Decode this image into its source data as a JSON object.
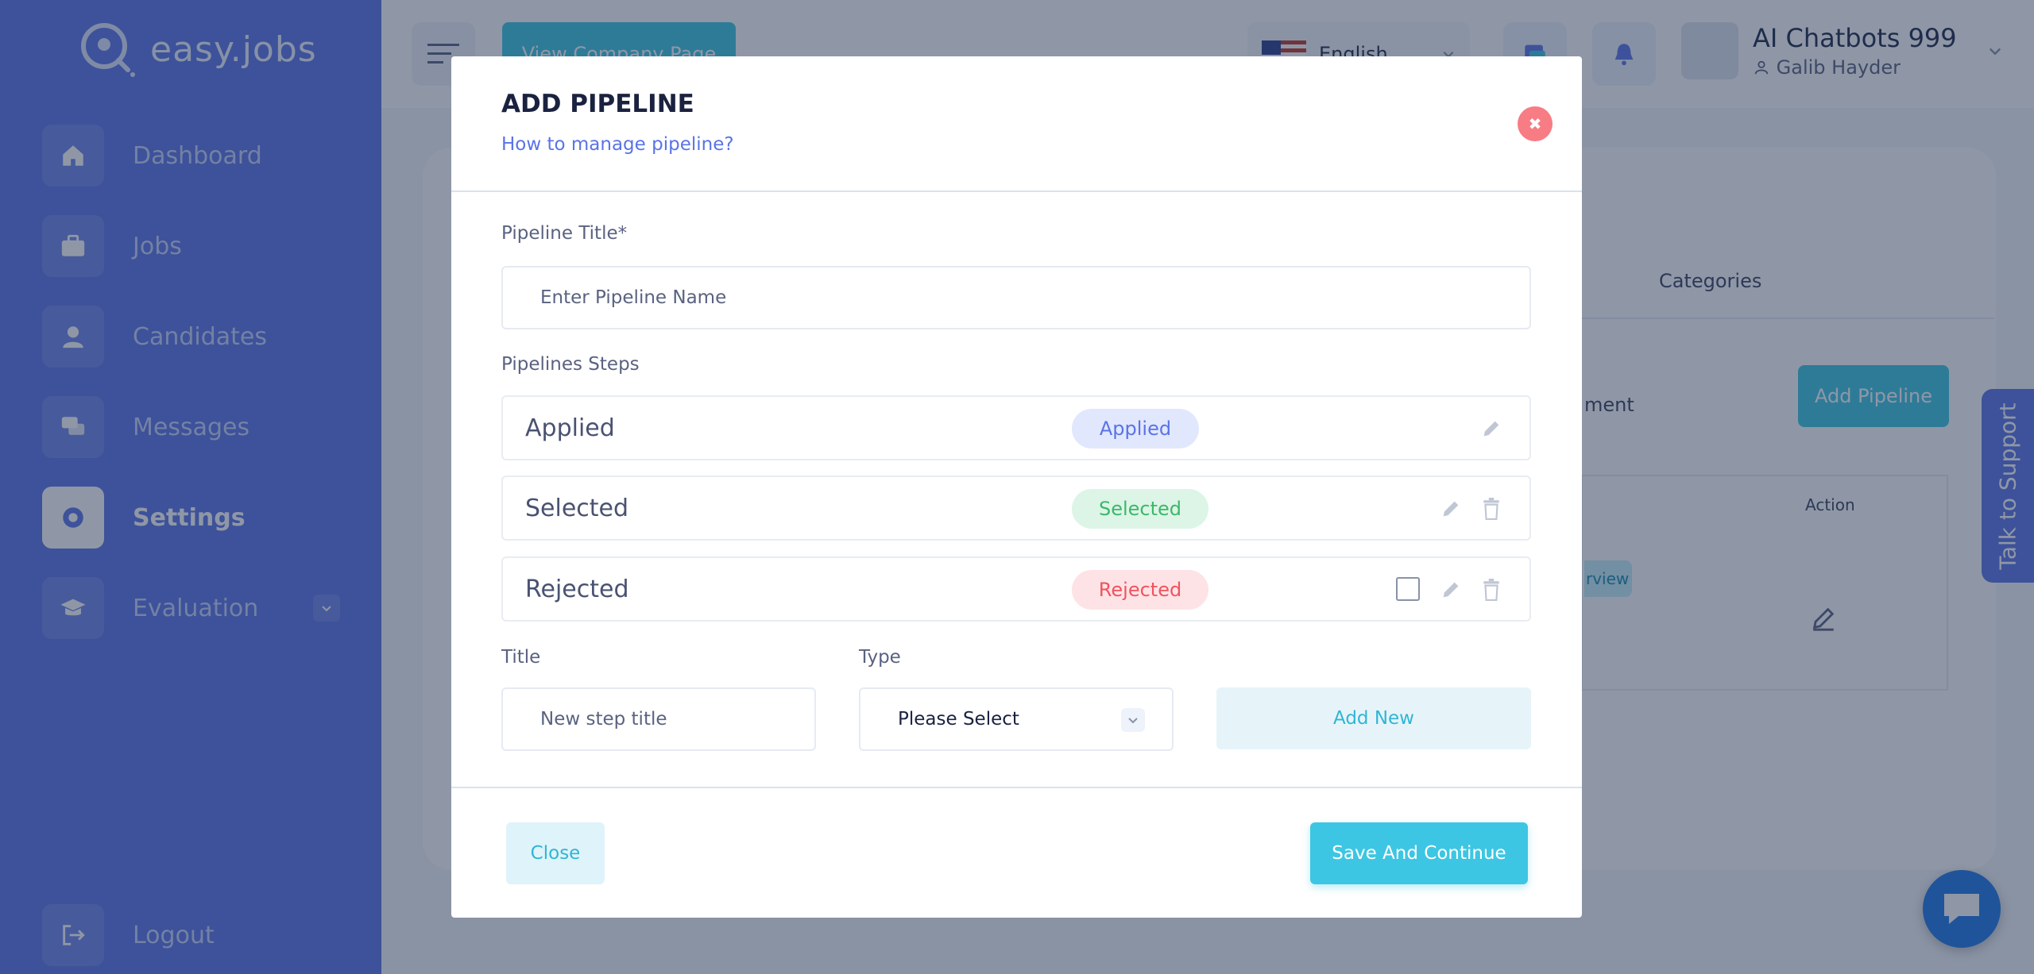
{
  "brand": {
    "name": "easy.jobs"
  },
  "sidebar": {
    "items": [
      {
        "label": "Dashboard",
        "icon": "home-icon"
      },
      {
        "label": "Jobs",
        "icon": "briefcase-icon"
      },
      {
        "label": "Candidates",
        "icon": "user-icon"
      },
      {
        "label": "Messages",
        "icon": "chat-icon"
      },
      {
        "label": "Settings",
        "icon": "gear-icon",
        "active": true
      },
      {
        "label": "Evaluation",
        "icon": "graduation-cap-icon"
      }
    ],
    "logout": "Logout"
  },
  "header": {
    "company_page_button": "View Company Page",
    "language": "English",
    "company": "AI Chatbots 999",
    "user": "Galib Hayder"
  },
  "background": {
    "tab_categories": "Categories",
    "add_pipeline_button": "Add Pipeline",
    "text_fragment": "ment",
    "table_action_header": "Action",
    "view_fragment": "rview"
  },
  "support": {
    "tab": "Talk to Support"
  },
  "modal": {
    "title": "ADD PIPELINE",
    "help_link": "How to manage pipeline?",
    "pipeline_title_label": "Pipeline Title*",
    "pipeline_title_placeholder": "Enter Pipeline Name",
    "steps_label": "Pipelines Steps",
    "steps": [
      {
        "name": "Applied",
        "badge": "Applied"
      },
      {
        "name": "Selected",
        "badge": "Selected"
      },
      {
        "name": "Rejected",
        "badge": "Rejected"
      }
    ],
    "title_label": "Title",
    "title_placeholder": "New step title",
    "type_label": "Type",
    "type_value": "Please Select",
    "add_new_button": "Add New",
    "close_button": "Close",
    "save_button": "Save And Continue"
  },
  "colors": {
    "sidebar": "#5a74e6",
    "accent": "#3dc6e3",
    "applied_badge": "#e1e7fd",
    "selected_badge": "#dcf5e6",
    "rejected_badge": "#fde3e5"
  }
}
